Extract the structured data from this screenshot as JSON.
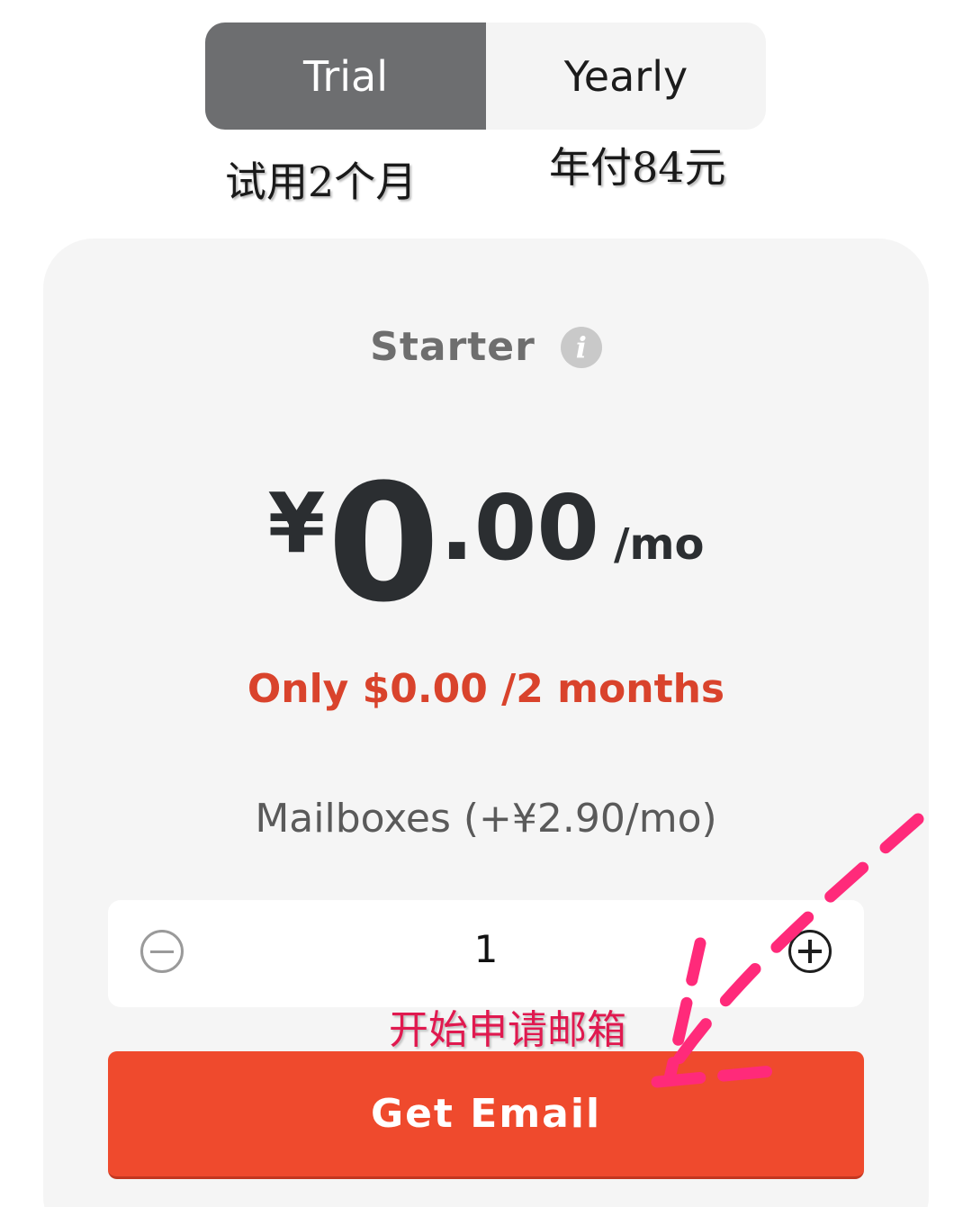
{
  "toggle": {
    "options": [
      {
        "label": "Trial",
        "selected": true
      },
      {
        "label": "Yearly",
        "selected": false
      }
    ]
  },
  "annotations": {
    "trial_note": "试用2个月",
    "yearly_note": "年付84元",
    "cta_note": "开始申请邮箱"
  },
  "plan": {
    "name": "Starter",
    "price_currency": "¥",
    "price_integer": "0",
    "price_decimal": ".00",
    "price_period": "/mo",
    "promo": "Only $0.00 /2 months",
    "mailbox_label": "Mailboxes (+¥2.90/mo)",
    "mailbox_count": "1",
    "cta_label": "Get Email"
  },
  "colors": {
    "selected_toggle": "#6d6e70",
    "cta": "#ef4a2d",
    "promo": "#d9432c",
    "annotation_arrow": "#ff2a7a"
  },
  "icons": {
    "info": "info-icon",
    "minus": "minus-circle-icon",
    "plus": "plus-circle-icon"
  }
}
